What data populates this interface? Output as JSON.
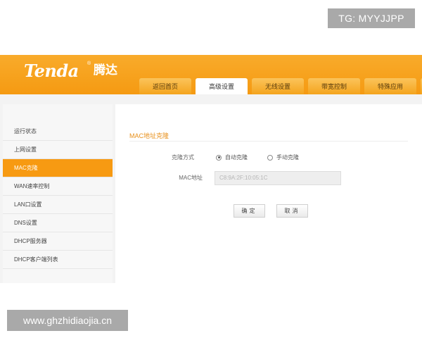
{
  "watermarks": {
    "top": "TG: MYYJJPP",
    "bottom": "www.ghzhidiaojia.cn"
  },
  "brand": {
    "logo": "Tenda",
    "chinese": "腾达",
    "reg": "®"
  },
  "tabs": [
    {
      "label": "返回首页",
      "active": false
    },
    {
      "label": "高级设置",
      "active": true
    },
    {
      "label": "无线设置",
      "active": false
    },
    {
      "label": "带宽控制",
      "active": false
    },
    {
      "label": "特殊应用",
      "active": false
    }
  ],
  "sidebar": {
    "items": [
      {
        "label": "运行状态",
        "active": false
      },
      {
        "label": "上网设置",
        "active": false
      },
      {
        "label": "MAC克隆",
        "active": true
      },
      {
        "label": "WAN速率控制",
        "active": false
      },
      {
        "label": "LAN口设置",
        "active": false
      },
      {
        "label": "DNS设置",
        "active": false
      },
      {
        "label": "DHCP服务器",
        "active": false
      },
      {
        "label": "DHCP客户端列表",
        "active": false
      }
    ]
  },
  "main": {
    "section_title": "MAC地址克隆",
    "clone_mode_label": "克隆方式",
    "options": [
      {
        "label": "自动克隆",
        "checked": true
      },
      {
        "label": "手动克隆",
        "checked": false
      }
    ],
    "mac_label": "MAC地址",
    "mac_value": "C8:9A:2F:10:05:1C",
    "ok_button": "确定",
    "cancel_button": "取消"
  },
  "colors": {
    "accent": "#f59a12",
    "tab": "#fbc45b",
    "title": "#e8901b"
  }
}
